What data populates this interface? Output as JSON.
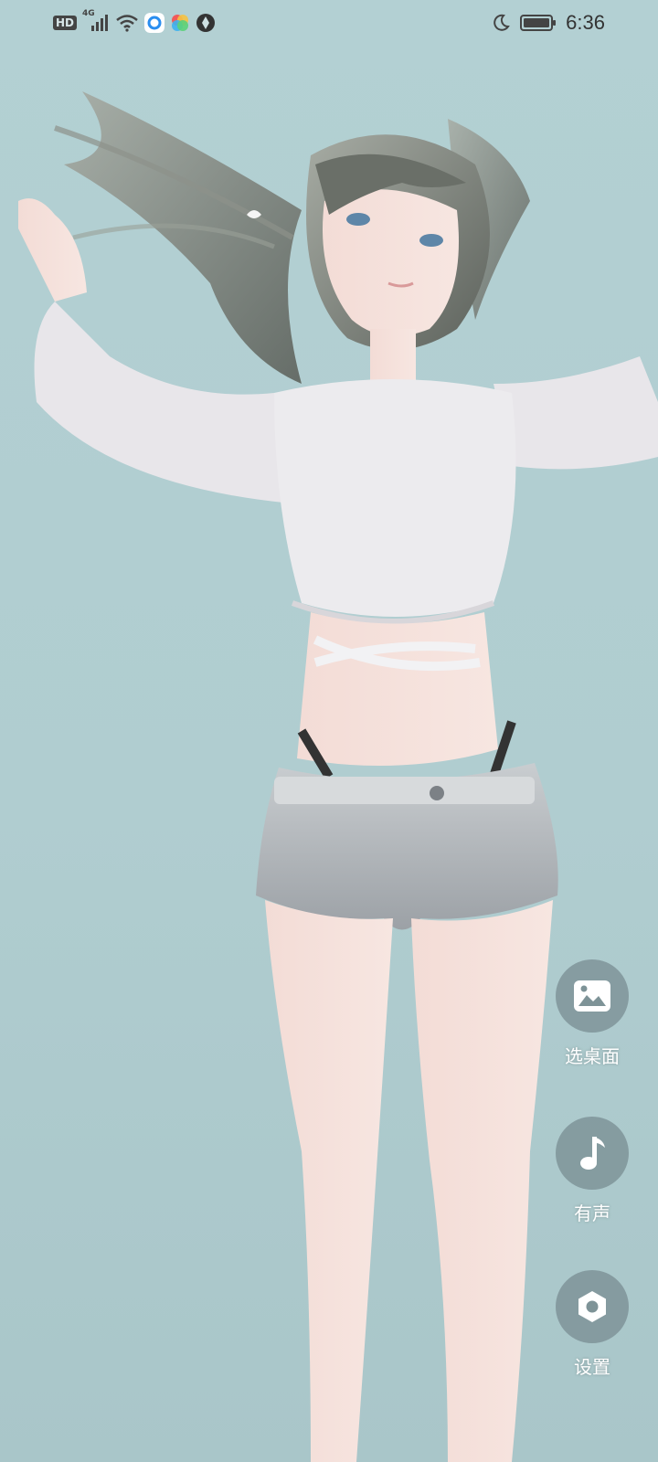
{
  "status_bar": {
    "hd_badge": "HD",
    "network": "4G",
    "time": "6:36",
    "icons": [
      "signal-icon",
      "wifi-icon",
      "app-icon-blue",
      "app-icon-colorful",
      "app-icon-aperture",
      "moon-icon",
      "battery-icon"
    ]
  },
  "wallpaper": {
    "subject": "anime-girl-dancing-figure"
  },
  "side_buttons": [
    {
      "label": "选桌面",
      "icon": "image-icon"
    },
    {
      "label": "有声",
      "icon": "music-note-icon"
    },
    {
      "label": "设置",
      "icon": "settings-icon"
    }
  ]
}
